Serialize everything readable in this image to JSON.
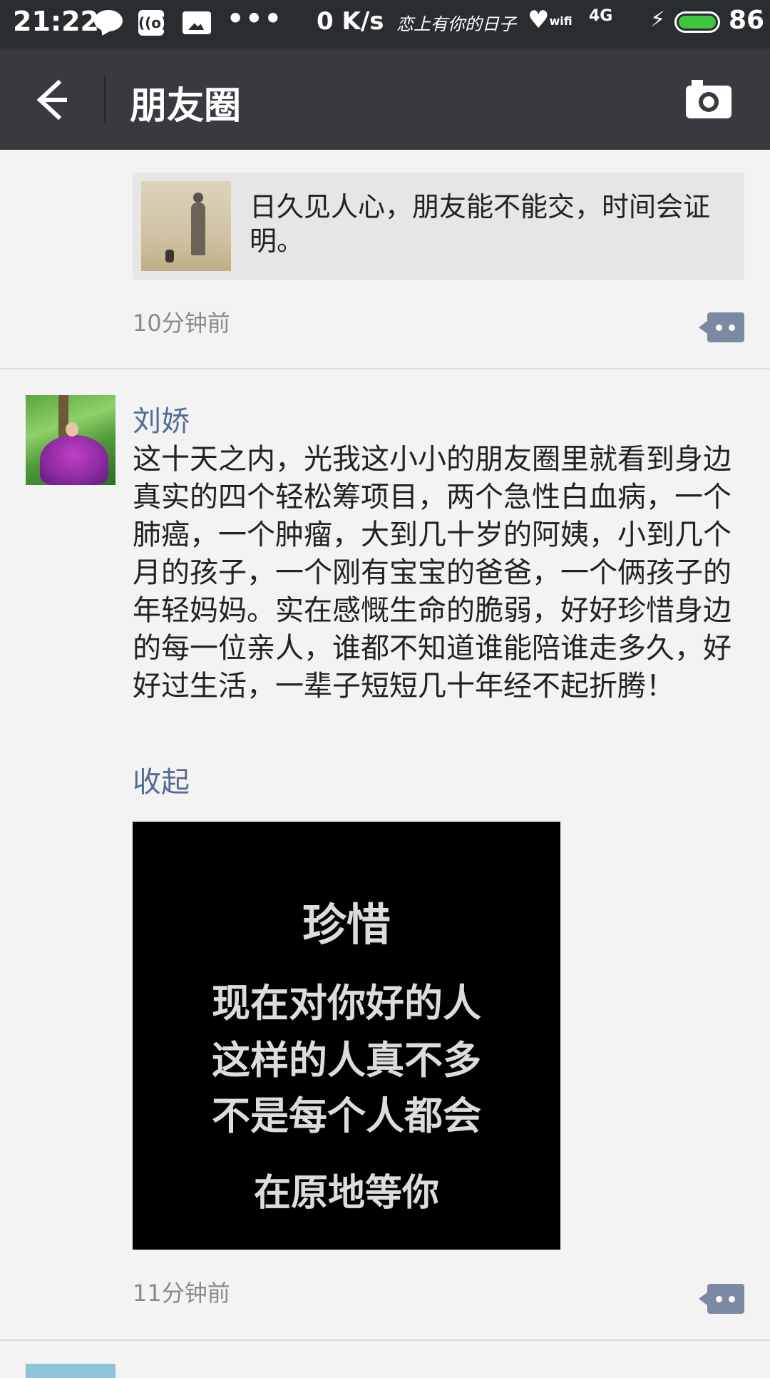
{
  "status_bar": {
    "time": "21:22",
    "speed": "0 K/s",
    "logo_text": "恋上有你的日子",
    "heart_label": "wifi",
    "signal": "4G",
    "battery": "86",
    "box1_label": "((o))"
  },
  "top_bar": {
    "title": "朋友圈"
  },
  "posts": [
    {
      "share_card": {
        "text": "日久见人心，朋友能不能交，时间会证明。"
      },
      "time": "10分钟前"
    },
    {
      "username": "刘娇",
      "text": "这十天之内，光我这小小的朋友圈里就看到身边真实的四个轻松筹项目，两个急性白血病，一个肺癌，一个肿瘤，大到几十岁的阿姨，小到几个月的孩子，一个刚有宝宝的爸爸，一个俩孩子的年轻妈妈。实在感慨生命的脆弱，好好珍惜身边的每一位亲人，谁都不知道谁能陪谁走多久，好好过生活，一辈子短短几十年经不起折腾！",
      "collapse_label": "收起",
      "image_lines": [
        "珍惜",
        "现在对你好的人",
        "这样的人真不多",
        "不是每个人都会",
        "在原地等你"
      ],
      "time": "11分钟前"
    }
  ],
  "colors": {
    "topbar": "#393a3f",
    "statusbar": "#2a2d30",
    "link_blue": "#576b95",
    "background": "#f3f3f3"
  },
  "icons": {
    "back": "arrow-left-icon",
    "camera": "camera-icon",
    "comment": "comment-icon"
  }
}
